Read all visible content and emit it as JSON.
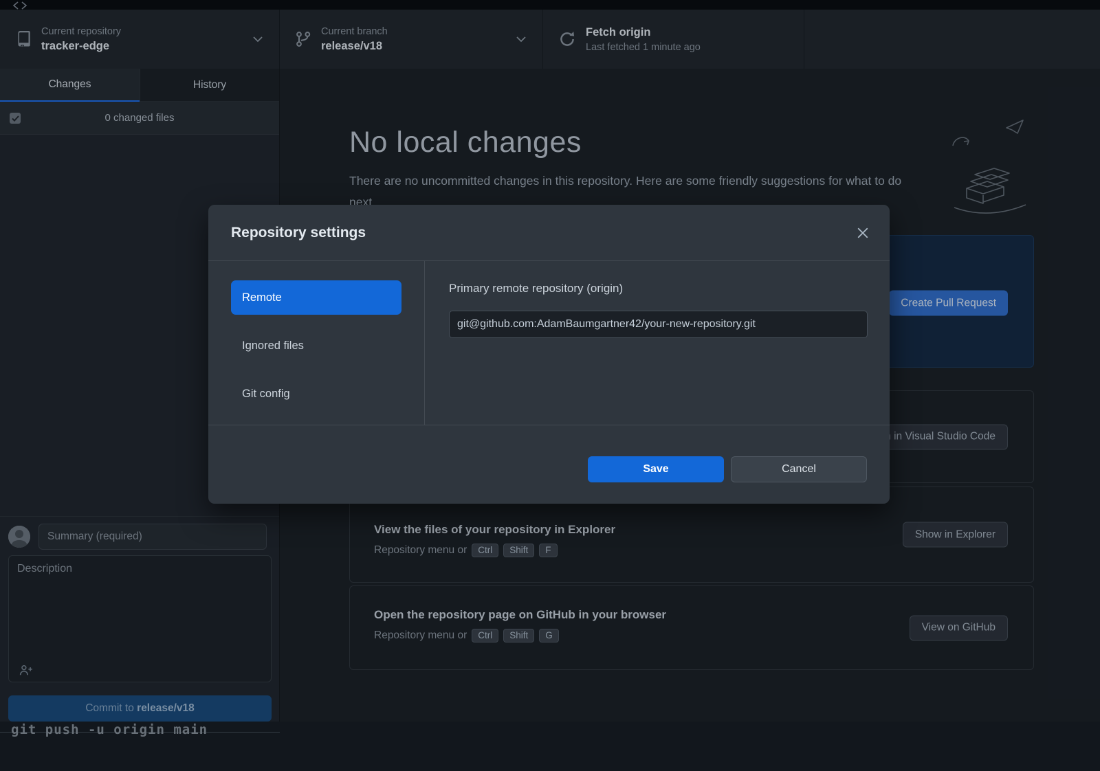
{
  "colors": {
    "accent_blue": "#1368d8",
    "tab_underline": "#1f6feb"
  },
  "toolbar": {
    "repo": {
      "label": "Current repository",
      "value": "tracker-edge"
    },
    "branch": {
      "label": "Current branch",
      "value": "release/v18"
    },
    "fetch": {
      "label": "Fetch origin",
      "status": "Last fetched 1 minute ago"
    }
  },
  "sidebar": {
    "tabs": [
      {
        "label": "Changes"
      },
      {
        "label": "History"
      }
    ],
    "files_header": "0 changed files",
    "commit": {
      "summary_placeholder": "Summary (required)",
      "description_placeholder": "Description",
      "button_prefix": "Commit to ",
      "branch": "release/v18"
    }
  },
  "main": {
    "title": "No local changes",
    "subtitle": "There are no uncommitted changes in this repository. Here are some friendly suggestions for what to do next.",
    "pr_card": {
      "button": "Create Pull Request"
    },
    "editor_card": {
      "button": "Open in Visual Studio Code"
    },
    "explorer_card": {
      "title": "View the files of your repository in Explorer",
      "hint": "Repository menu or",
      "keys": [
        "Ctrl",
        "Shift",
        "F"
      ],
      "button": "Show in Explorer"
    },
    "github_card": {
      "title": "Open the repository page on GitHub in your browser",
      "hint": "Repository menu or",
      "keys": [
        "Ctrl",
        "Shift",
        "G"
      ],
      "button": "View on GitHub"
    }
  },
  "dialog": {
    "title": "Repository settings",
    "nav": [
      {
        "label": "Remote"
      },
      {
        "label": "Ignored files"
      },
      {
        "label": "Git config"
      }
    ],
    "remote_section": {
      "label": "Primary remote repository (origin)",
      "url": "git@github.com:AdamBaumgartner42/your-new-repository.git"
    },
    "save": "Save",
    "cancel": "Cancel"
  },
  "background_terminal": {
    "text": "git push -u origin main"
  }
}
